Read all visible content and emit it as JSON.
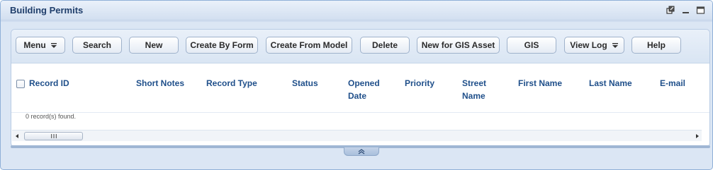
{
  "window": {
    "title": "Building Permits",
    "icons": [
      "popout-icon",
      "minimize-icon",
      "maximize-icon"
    ]
  },
  "toolbar": {
    "buttons": [
      {
        "label": "Menu",
        "dropdown": true
      },
      {
        "label": "Search"
      },
      {
        "label": "New"
      },
      {
        "label": "Create By Form"
      },
      {
        "label": "Create From Model"
      },
      {
        "label": "Delete"
      },
      {
        "label": "New for GIS Asset"
      },
      {
        "label": "GIS"
      },
      {
        "label": "View Log",
        "dropdown": true
      },
      {
        "label": "Help"
      }
    ]
  },
  "grid": {
    "columns": [
      {
        "line1": "Record ID",
        "line2": ""
      },
      {
        "line1": "Short Notes",
        "line2": ""
      },
      {
        "line1": "Record Type",
        "line2": ""
      },
      {
        "line1": "Status",
        "line2": ""
      },
      {
        "line1": "Opened",
        "line2": "Date"
      },
      {
        "line1": "Priority",
        "line2": ""
      },
      {
        "line1": "Street",
        "line2": "Name"
      },
      {
        "line1": "First Name",
        "line2": ""
      },
      {
        "line1": "Last Name",
        "line2": ""
      },
      {
        "line1": "E-mail",
        "line2": ""
      }
    ],
    "status": "0 record(s) found."
  },
  "colors": {
    "title": "#1f3e6b",
    "column_header": "#1f4f8a",
    "panel_border": "#8fb0d8"
  }
}
